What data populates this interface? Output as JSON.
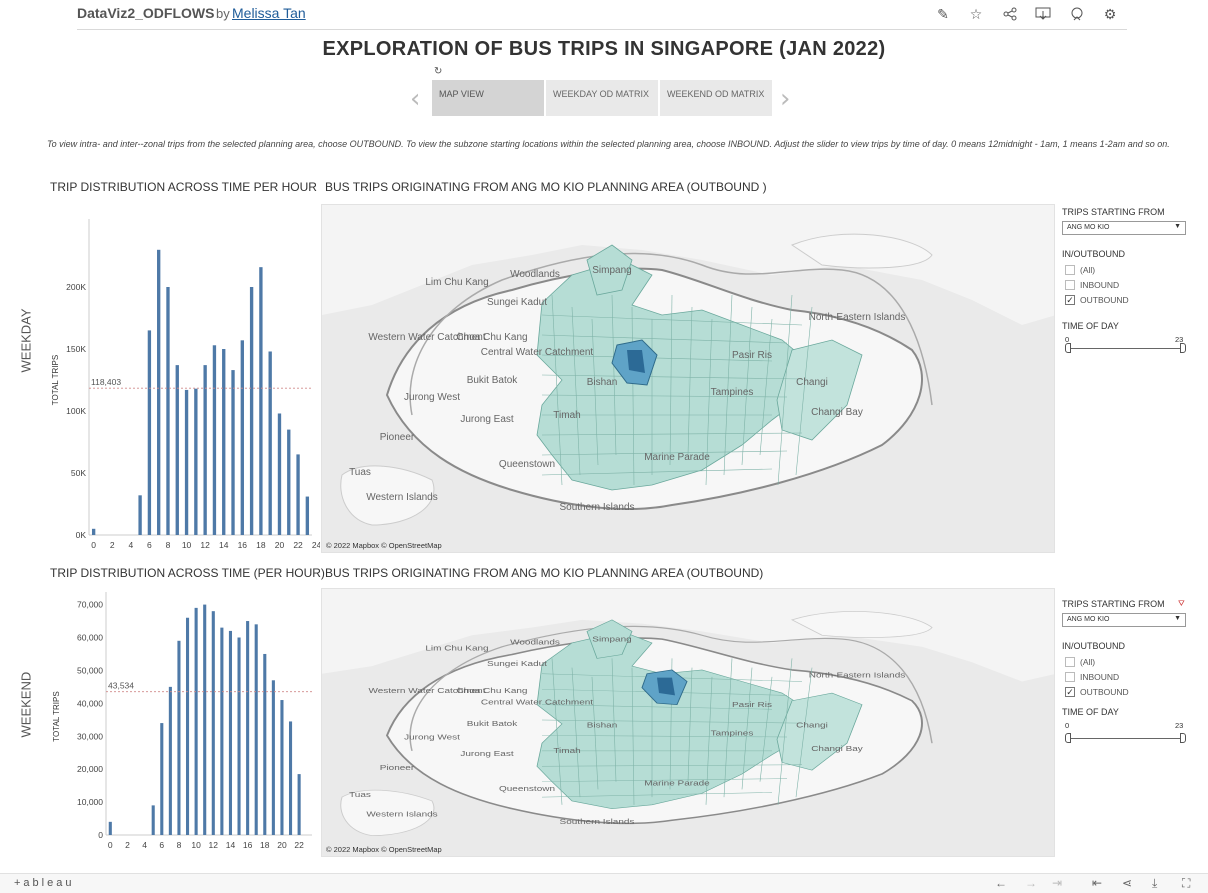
{
  "header": {
    "workbook": "DataViz2_ODFLOWS",
    "by": "by",
    "author": "Melissa Tan",
    "tools": [
      "edit-icon",
      "star-icon",
      "share-icon",
      "download-icon",
      "metrics-icon",
      "settings-icon"
    ]
  },
  "dashboard_title": "EXPLORATION OF BUS TRIPS IN SINGAPORE (JAN 2022)",
  "tabs": [
    {
      "label": "MAP VIEW",
      "active": true
    },
    {
      "label": "WEEKDAY OD MATRIX",
      "active": false
    },
    {
      "label": "WEEKEND OD MATRIX",
      "active": false
    }
  ],
  "instructions": "To view intra- and inter--zonal trips from the selected planning area, choose OUTBOUND. To view the subzone starting locations within the selected planning area, choose INBOUND. Adjust the slider to view trips by time of day. 0 means 12midnight - 1am, 1 means 1-2am and so on.",
  "weekday": {
    "row_label": "WEEKDAY",
    "chart_title": "TRIP DISTRIBUTION ACROSS TIME PER HOUR",
    "map_title": "BUS TRIPS ORIGINATING FROM ANG MO KIO PLANNING AREA (OUTBOUND )",
    "map_credit": "© 2022 Mapbox  © OpenStreetMap"
  },
  "weekend": {
    "row_label": "WEEKEND",
    "chart_title": "TRIP DISTRIBUTION ACROSS TIME (PER HOUR)",
    "map_title": "BUS TRIPS ORIGINATING FROM ANG MO KIO PLANNING AREA (OUTBOUND)",
    "map_credit": "© 2022 Mapbox  © OpenStreetMap"
  },
  "map_labels": [
    "Woodlands",
    "Simpang",
    "Lim Chu Kang",
    "Sungei Kadut",
    "Western Water Catchment",
    "Choa Chu Kang",
    "Central Water Catchment",
    "Bukit Batok",
    "Bishan",
    "Jurong West",
    "Jurong East",
    "Pioneer",
    "Tuas",
    "Western Islands",
    "Queenstown",
    "Southern Islands",
    "Marine Parade",
    "Changi Bay",
    "North-Eastern Islands",
    "Pasir Ris",
    "Tampines",
    "Changi",
    "Timah"
  ],
  "filters": {
    "weekday": {
      "trips_from_label": "TRIPS STARTING FROM",
      "trips_from_value": "ANG MO KIO",
      "inout_label": "IN/OUTBOUND",
      "options": [
        {
          "label": "(All)",
          "checked": false
        },
        {
          "label": "INBOUND",
          "checked": false
        },
        {
          "label": "OUTBOUND",
          "checked": true
        }
      ],
      "time_label": "TIME OF DAY",
      "time_min": "0",
      "time_max": "23"
    },
    "weekend": {
      "trips_from_label": "TRIPS STARTING FROM",
      "trips_from_value": "ANG MO KIO",
      "inout_label": "IN/OUTBOUND",
      "options": [
        {
          "label": "(All)",
          "checked": false
        },
        {
          "label": "INBOUND",
          "checked": false
        },
        {
          "label": "OUTBOUND",
          "checked": true
        }
      ],
      "time_label": "TIME OF DAY",
      "time_min": "0",
      "time_max": "23"
    }
  },
  "chart_data": [
    {
      "type": "bar",
      "ylabel": "TOTAL TRIPS",
      "x_ticks": [
        "0",
        "2",
        "4",
        "6",
        "8",
        "10",
        "12",
        "14",
        "16",
        "18",
        "20",
        "22",
        "24"
      ],
      "y_ticks": [
        "0K",
        "50K",
        "100K",
        "150K",
        "200K"
      ],
      "ylim": [
        0,
        250000
      ],
      "reference_line": {
        "value": 118403,
        "label": "118,403"
      },
      "x": [
        0,
        1,
        2,
        3,
        4,
        5,
        6,
        7,
        8,
        9,
        10,
        11,
        12,
        13,
        14,
        15,
        16,
        17,
        18,
        19,
        20,
        21,
        22,
        23
      ],
      "values": [
        5000,
        0,
        0,
        0,
        0,
        32000,
        165000,
        230000,
        200000,
        137000,
        117000,
        118000,
        137000,
        153000,
        150000,
        133000,
        157000,
        200000,
        216000,
        148000,
        98000,
        85000,
        65000,
        31000
      ]
    },
    {
      "type": "bar",
      "ylabel": "TOTAL TRIPS",
      "x_ticks": [
        "0",
        "2",
        "4",
        "6",
        "8",
        "10",
        "12",
        "14",
        "16",
        "18",
        "20",
        "22"
      ],
      "y_ticks": [
        "0",
        "10,000",
        "20,000",
        "30,000",
        "40,000",
        "50,000",
        "60,000",
        "70,000"
      ],
      "ylim": [
        0,
        72000
      ],
      "reference_line": {
        "value": 43534,
        "label": "43,534"
      },
      "x": [
        0,
        1,
        2,
        3,
        4,
        5,
        6,
        7,
        8,
        9,
        10,
        11,
        12,
        13,
        14,
        15,
        16,
        17,
        18,
        19,
        20,
        21,
        22,
        23
      ],
      "values": [
        4000,
        0,
        0,
        0,
        0,
        9000,
        34000,
        45000,
        59000,
        66000,
        69000,
        70000,
        68000,
        63000,
        62000,
        60000,
        65000,
        64000,
        55000,
        47000,
        41000,
        34500,
        18500,
        0
      ]
    }
  ],
  "footer": {
    "logo": "+ableau"
  }
}
